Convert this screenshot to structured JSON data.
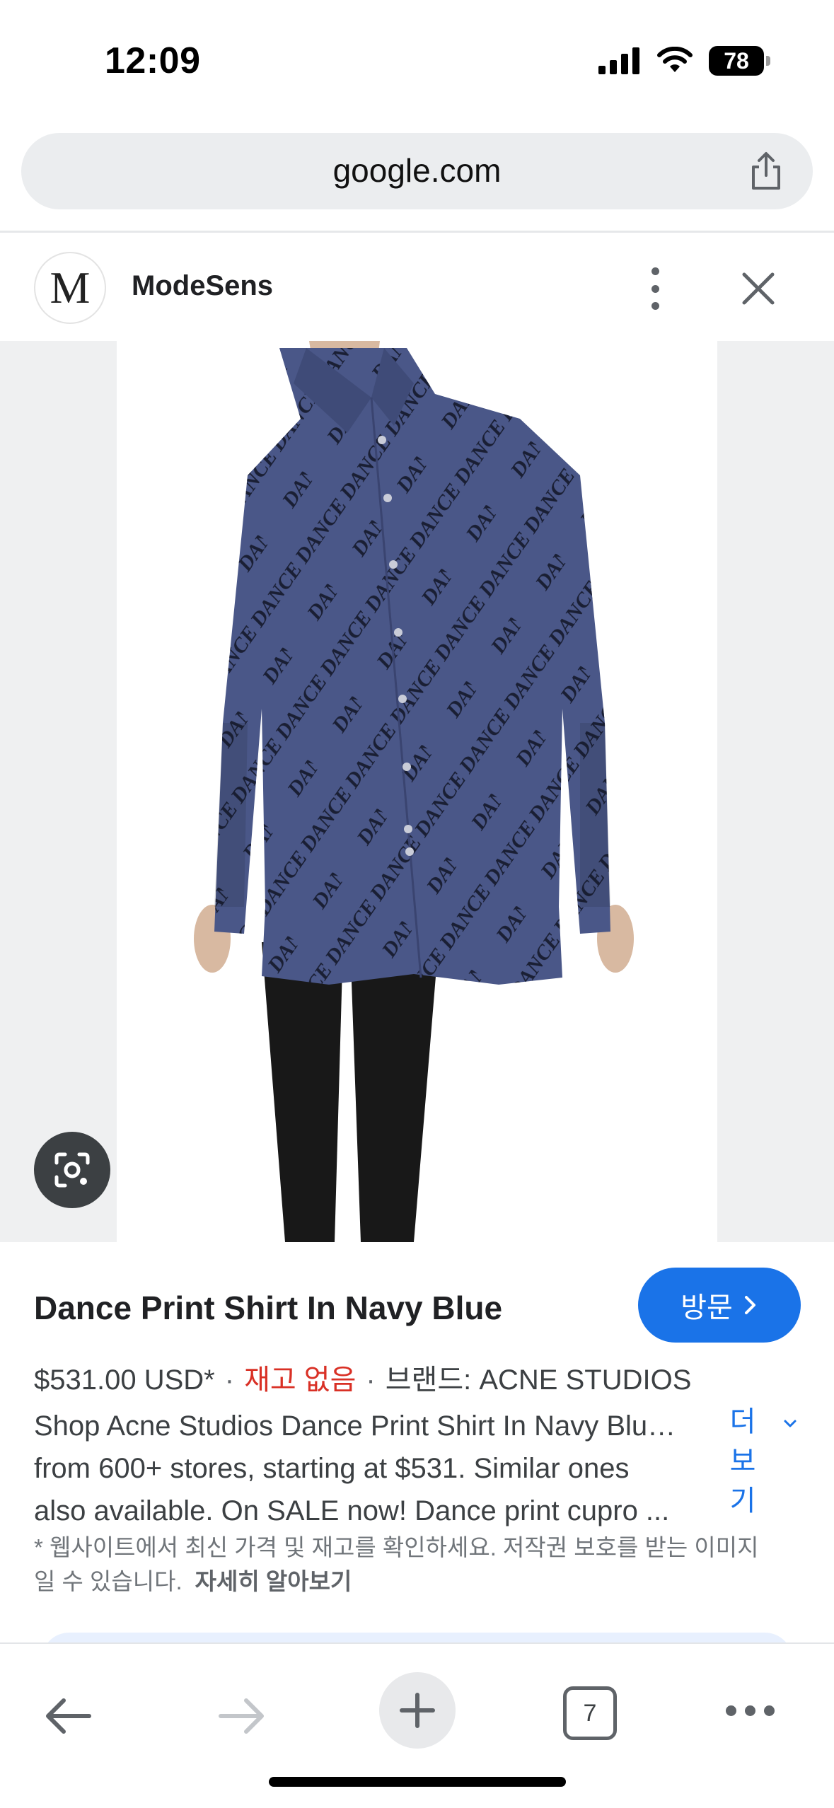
{
  "status_bar": {
    "time": "12:09",
    "battery": "78",
    "icons": [
      "cellular-signal-icon",
      "wifi-icon",
      "battery-icon"
    ]
  },
  "browser": {
    "url": "google.com",
    "share_icon": "share-icon"
  },
  "source": {
    "logo_letter": "M",
    "name": "ModeSens",
    "more_icon": "vertical-dots-icon",
    "close_icon": "close-icon"
  },
  "image": {
    "print_text": "DANCE",
    "lens_icon": "google-lens-icon",
    "colors": {
      "shirt": "#4a5788",
      "print": "#15192b",
      "pants": "#181818",
      "skin": "#d8b9a1"
    }
  },
  "product": {
    "title": "Dance Print Shirt In Navy Blue",
    "visit_label": "방문",
    "price": "$531.00 USD*",
    "stock_status": "재고 없음",
    "brand": "브랜드: ACNE STUDIOS",
    "description_lines": [
      "Shop Acne Studios Dance Print Shirt In Navy Blu…",
      "from 600+ stores, starting at $531. Similar ones",
      "also available. On SALE now! Dance print cupro ..."
    ],
    "more_label_lines": [
      "더",
      "보",
      "기"
    ],
    "footnote_lines": [
      "* 웹사이트에서 최신 가격 및 재고를 확인하세요. 저작권 보호를 받는 이미지",
      "일 수 있습니다."
    ],
    "learn_more": "자세히 알아보기"
  },
  "toolbar": {
    "tab_count": "7",
    "icons": [
      "back-arrow-icon",
      "forward-arrow-icon",
      "plus-icon",
      "tabs-icon",
      "more-horizontal-icon"
    ]
  },
  "colors": {
    "accent": "#1a73e8",
    "out_of_stock": "#d93025",
    "image_backdrop": "#eff0f1"
  }
}
